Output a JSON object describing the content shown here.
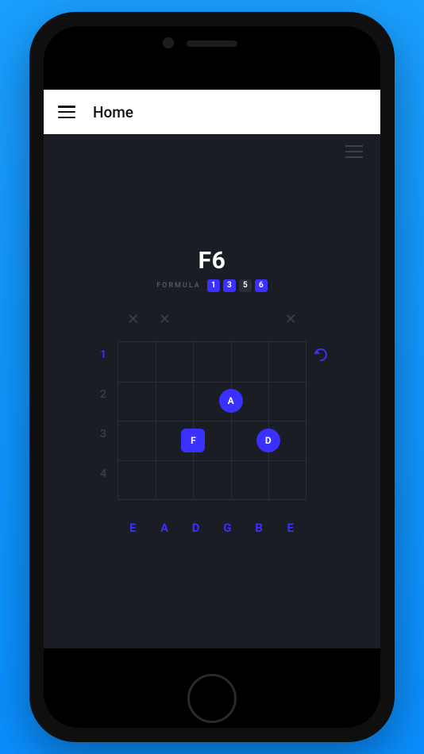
{
  "header": {
    "title": "Home"
  },
  "chord": {
    "name": "F6",
    "formula_label": "FORMULA",
    "formula": [
      {
        "v": "1",
        "active": true
      },
      {
        "v": "3",
        "active": true
      },
      {
        "v": "5",
        "active": false
      },
      {
        "v": "6",
        "active": true
      }
    ]
  },
  "fretboard": {
    "top_markers": [
      "x",
      "x",
      "dot",
      "dot",
      "dot",
      "x"
    ],
    "fret_numbers": [
      "1",
      "2",
      "3",
      "4"
    ],
    "active_fret_index": 0,
    "strings": [
      "E",
      "A",
      "D",
      "G",
      "B",
      "E"
    ],
    "notes": [
      {
        "label": "A",
        "string": 4,
        "fret": 2,
        "shape": "circle"
      },
      {
        "label": "F",
        "string": 3,
        "fret": 3,
        "shape": "square"
      },
      {
        "label": "D",
        "string": 5,
        "fret": 3,
        "shape": "circle"
      }
    ],
    "rows": 4,
    "cols": 6
  }
}
